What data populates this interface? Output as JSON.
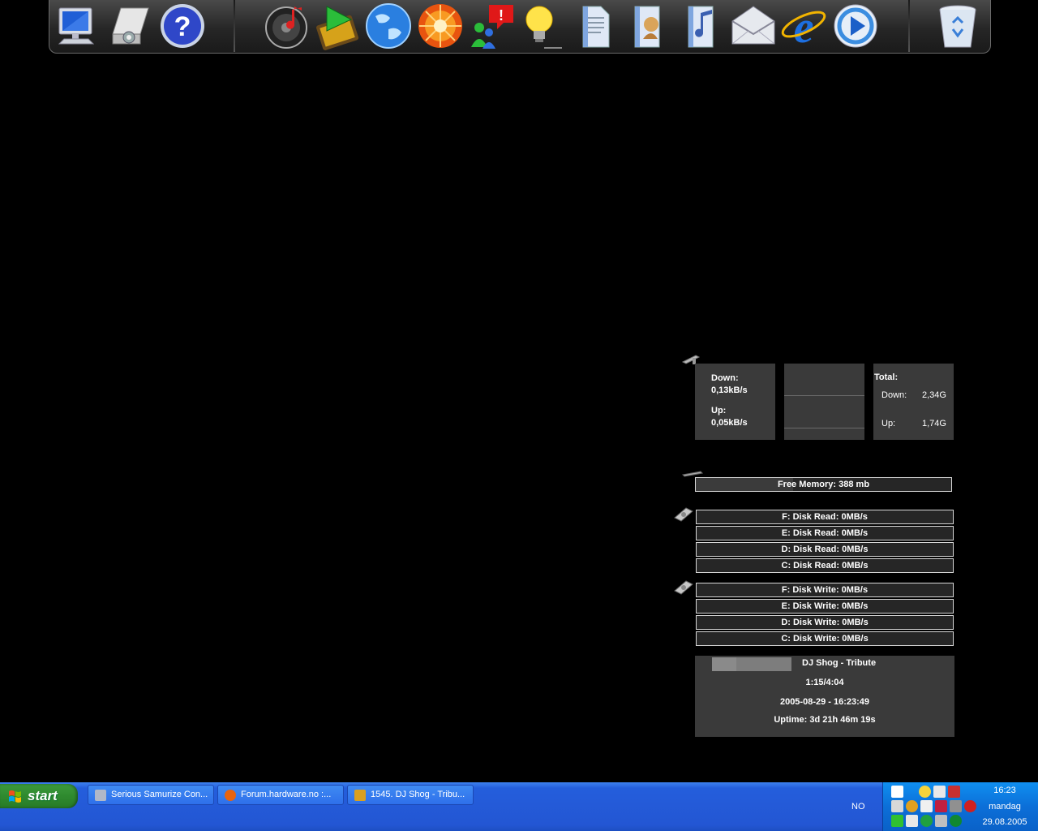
{
  "dock": {
    "left_icons": [
      "my-computer-icon",
      "control-panel-icon",
      "help-icon"
    ],
    "middle_icons": [
      "music-cd-icon",
      "media-player-icon",
      "network-globe-icon",
      "firefox-icon",
      "messenger-icon",
      "lightbulb-icon",
      "documents-icon",
      "pictures-icon",
      "music-folder-icon",
      "email-icon",
      "internet-explorer-icon",
      "media-play-icon"
    ],
    "right_icons": [
      "recycle-bin-icon"
    ]
  },
  "network": {
    "down_label": "Down:",
    "down_value": "0,13kB/s",
    "up_label": "Up:",
    "up_value": "0,05kB/s",
    "total_label": "Total:",
    "total_down_label": "Down:",
    "total_down_value": "2,34G",
    "total_up_label": "Up:",
    "total_up_value": "1,74G"
  },
  "memory": {
    "label": "Free Memory: 388 mb",
    "used_fraction": 0.38
  },
  "disk_read": [
    "F: Disk Read: 0MB/s",
    "E: Disk Read: 0MB/s",
    "D: Disk Read: 0MB/s",
    "C: Disk Read: 0MB/s"
  ],
  "disk_write": [
    "F: Disk Write: 0MB/s",
    "E: Disk Write: 0MB/s",
    "D: Disk Write: 0MB/s",
    "C: Disk Write: 0MB/s"
  ],
  "media": {
    "track": "DJ Shog - Tribute",
    "position": "1:15/4:04",
    "progress_fraction": 0.31,
    "datetime": "2005-08-29 - 16:23:49",
    "uptime": "Uptime: 3d 21h 46m 19s"
  },
  "taskbar": {
    "start_label": "start",
    "tasks": [
      {
        "label": "Serious Samurize Con...",
        "icon": "samurize-icon"
      },
      {
        "label": "Forum.hardware.no :...",
        "icon": "firefox-icon"
      },
      {
        "label": "1545. DJ Shog - Tribu...",
        "icon": "winamp-icon"
      }
    ],
    "language": "NO",
    "clock_time": "16:23",
    "clock_day": "mandag",
    "clock_date": "29.08.2005"
  }
}
